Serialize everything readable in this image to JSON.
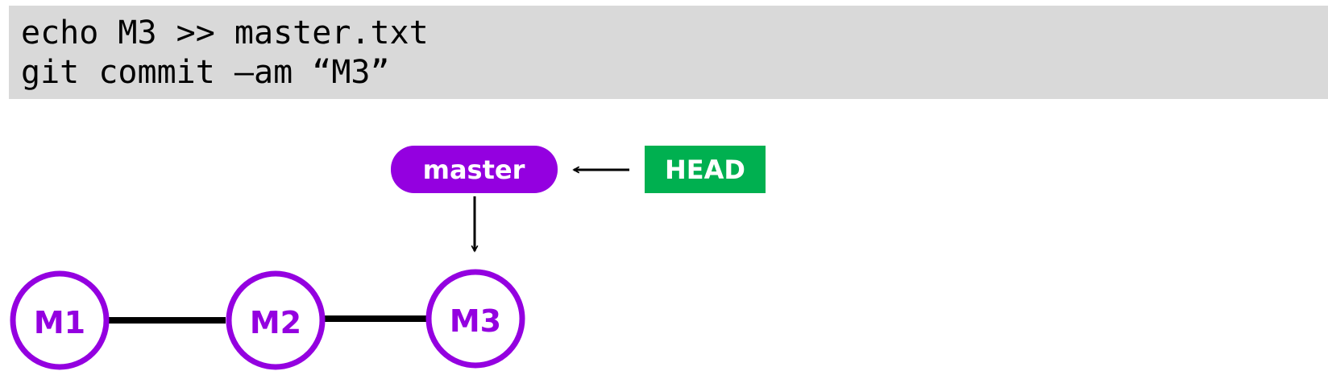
{
  "code": {
    "lines": [
      "echo M3 >> master.txt",
      "git commit –am “M3”"
    ]
  },
  "diagram": {
    "commits": [
      {
        "id": "M1",
        "label": "M1"
      },
      {
        "id": "M2",
        "label": "M2"
      },
      {
        "id": "M3",
        "label": "M3"
      }
    ],
    "branch": {
      "label": "master",
      "points_to": "M3"
    },
    "head": {
      "label": "HEAD",
      "points_to": "master"
    },
    "colors": {
      "commit": "#9400e0",
      "branch_fill": "#9400e0",
      "branch_text": "#ffffff",
      "head_fill": "#00b050",
      "head_text": "#ffffff",
      "edge": "#000000",
      "code_bg": "#d9d9d9"
    }
  }
}
